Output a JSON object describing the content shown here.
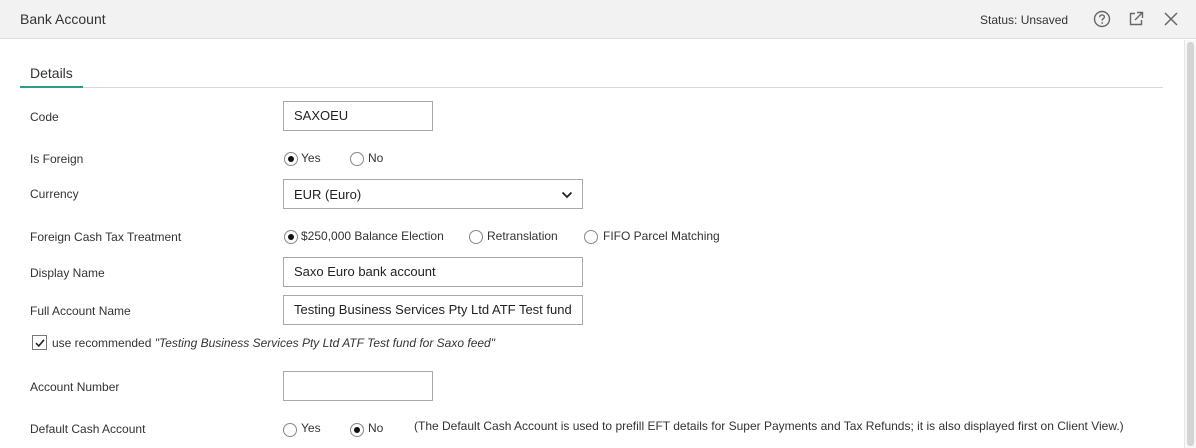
{
  "window": {
    "title": "Bank Account",
    "status": "Status: Unsaved",
    "icons": [
      "help-icon",
      "popout-icon",
      "close-icon"
    ]
  },
  "tabs": [
    {
      "label": "Details",
      "active": true
    }
  ],
  "form": {
    "code": {
      "label": "Code",
      "value": "SAXOEU"
    },
    "is_foreign": {
      "label": "Is Foreign",
      "options": [
        "Yes",
        "No"
      ],
      "selected": "Yes"
    },
    "currency": {
      "label": "Currency",
      "value": "EUR (Euro)"
    },
    "foreign_cash_tax": {
      "label": "Foreign Cash Tax Treatment",
      "options": [
        "$250,000 Balance Election",
        "Retranslation",
        "FIFO Parcel Matching"
      ],
      "selected": "$250,000 Balance Election"
    },
    "display_name": {
      "label": "Display Name",
      "value": "Saxo Euro bank account"
    },
    "full_account_name": {
      "label": "Full Account Name",
      "value": "Testing Business Services Pty Ltd ATF Test fund"
    },
    "use_recommended": {
      "checked": true,
      "prefix": "use recommended",
      "suggestion": "\"Testing Business Services Pty Ltd ATF Test fund for Saxo feed\""
    },
    "account_number": {
      "label": "Account Number",
      "value": ""
    },
    "default_cash": {
      "label": "Default Cash Account",
      "options": [
        "Yes",
        "No"
      ],
      "selected": "No",
      "note": "(The Default Cash Account is used to prefill EFT details for Super Payments and Tax Refunds; it is also displayed first on Client View.)"
    }
  },
  "colors": {
    "accent": "#2a9d8f",
    "titlebar": "#f2f2f2"
  }
}
